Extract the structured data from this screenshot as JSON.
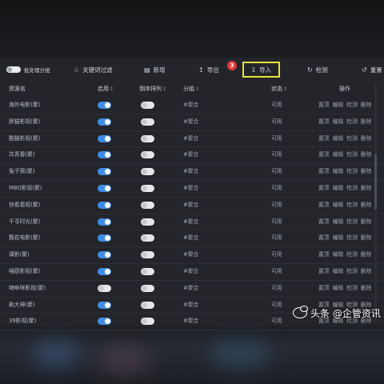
{
  "toolbar": {
    "batch_group_label": "批处理分组",
    "keyword_filter_label": "关键词过滤",
    "add_label": "新增",
    "export_label": "导出",
    "import_label": "导入",
    "check_label": "检测",
    "reset_label": "重置",
    "step_badge": "3"
  },
  "table": {
    "headers": {
      "name": "资源名",
      "enable": "启用",
      "sort": "倒序排列",
      "group": "分组",
      "status": "状态",
      "ops": "操作"
    },
    "op_labels": [
      "置顶",
      "编辑",
      "检测",
      "删除"
    ],
    "rows": [
      {
        "name": "海外电影(聚)",
        "enabled": true,
        "sort": false,
        "group": "#聚合",
        "status": "可用"
      },
      {
        "name": "胖猫影视(聚)",
        "enabled": true,
        "sort": false,
        "group": "#聚合",
        "status": "可用"
      },
      {
        "name": "酷猫影视(聚)",
        "enabled": true,
        "sort": false,
        "group": "#聚合",
        "status": "可用"
      },
      {
        "name": "共青春(聚)",
        "enabled": true,
        "sort": false,
        "group": "#聚合",
        "status": "可用"
      },
      {
        "name": "兔子窝(聚)",
        "enabled": true,
        "sort": false,
        "group": "#聚合",
        "status": "可用"
      },
      {
        "name": "MBO影视(聚)",
        "enabled": true,
        "sort": false,
        "group": "#聚合",
        "status": "可用"
      },
      {
        "name": "快看看视(聚)",
        "enabled": true,
        "sort": false,
        "group": "#聚合",
        "status": "可用"
      },
      {
        "name": "千寻时光(聚)",
        "enabled": true,
        "sort": false,
        "group": "#聚合",
        "status": "可用"
      },
      {
        "name": "飘花电影(聚)",
        "enabled": true,
        "sort": false,
        "group": "#聚合",
        "status": "可用"
      },
      {
        "name": "课影(聚)",
        "enabled": true,
        "sort": false,
        "group": "#聚合",
        "status": "可用"
      },
      {
        "name": "喵厨影视(聚)",
        "enabled": true,
        "sort": false,
        "group": "#聚合",
        "status": "可用"
      },
      {
        "name": "嗨咻咪影视(聚)",
        "enabled": false,
        "sort": false,
        "group": "#聚合",
        "status": "可用"
      },
      {
        "name": "剧大神(聚)",
        "enabled": true,
        "sort": false,
        "group": "#聚合",
        "status": "可用"
      },
      {
        "name": "39影视(聚)",
        "enabled": true,
        "sort": false,
        "group": "#聚合",
        "status": "可用"
      }
    ]
  },
  "watermark": {
    "text": "头条 @企管资讯"
  },
  "colors": {
    "accent": "#3d8de8",
    "highlight": "#e8e23a",
    "badge": "#e03a3a",
    "panel": "#23252a"
  }
}
